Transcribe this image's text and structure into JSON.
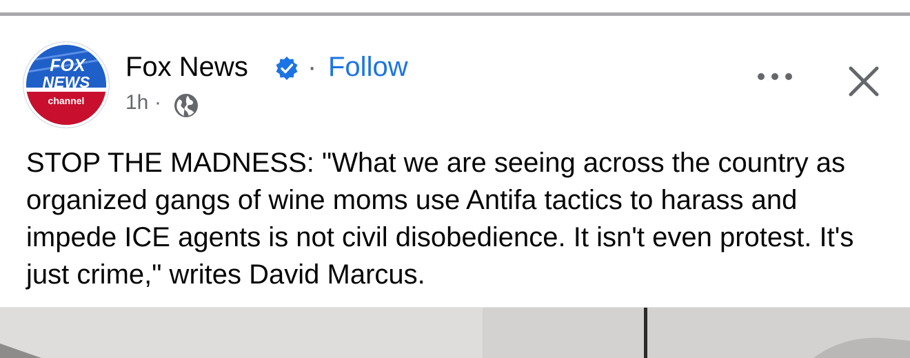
{
  "post": {
    "page_name": "Fox News",
    "verified": true,
    "separator": "·",
    "follow_label": "Follow",
    "timestamp": "1h",
    "meta_separator": "·",
    "audience_icon": "globe-icon",
    "more_icon": "more-options-icon",
    "close_icon": "close-icon",
    "body_text": "STOP THE MADNESS: \"What we are seeing across the country as organized gangs of wine moms use Antifa tactics to harass and impede ICE agents is not civil disobedience. It isn't even protest. It's just crime,\" writes David Marcus."
  },
  "logo": {
    "line1": "FOX",
    "line2": "NEWS",
    "line3": "channel"
  },
  "colors": {
    "follow_link": "#1b74e4",
    "verified_badge": "#1b74e4",
    "secondary_text": "#65676b",
    "primary_text": "#050505",
    "divider": "#a9a9ad",
    "logo_blue": "#1f5fc8",
    "logo_red": "#c8102e"
  }
}
